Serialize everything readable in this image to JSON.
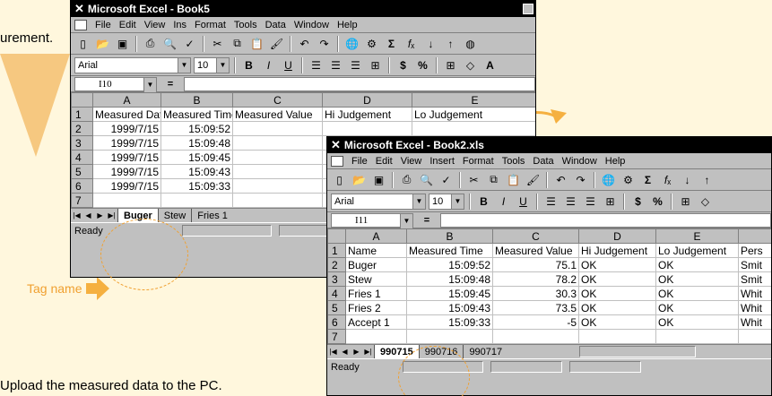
{
  "captions": {
    "top_fragment": "urement.",
    "bottom": "Upload the measured data to the PC.",
    "tag_name": "Tag name"
  },
  "colors": {
    "accent": "#f0a030",
    "background": "#fff7dd"
  },
  "window1": {
    "title": "Microsoft Excel - Book5",
    "menu": [
      "File",
      "Edit",
      "View",
      "Ins",
      "Format",
      "Tools",
      "Data",
      "Window",
      "Help"
    ],
    "font": "Arial",
    "size": "10",
    "cell_ref": "I10",
    "eq": "=",
    "columns": [
      "A",
      "B",
      "C",
      "D",
      "E"
    ],
    "rows": [
      {
        "n": "1",
        "cells": [
          "Measured Date",
          "Measured Time",
          "Measured Value",
          "Hi Judgement",
          "Lo Judgement"
        ]
      },
      {
        "n": "2",
        "cells": [
          "1999/7/15",
          "15:09:52",
          "",
          "",
          ""
        ]
      },
      {
        "n": "3",
        "cells": [
          "1999/7/15",
          "15:09:48",
          "",
          "",
          ""
        ]
      },
      {
        "n": "4",
        "cells": [
          "1999/7/15",
          "15:09:45",
          "",
          "",
          ""
        ]
      },
      {
        "n": "5",
        "cells": [
          "1999/7/15",
          "15:09:43",
          "",
          "",
          ""
        ]
      },
      {
        "n": "6",
        "cells": [
          "1999/7/15",
          "15:09:33",
          "",
          "",
          ""
        ]
      },
      {
        "n": "7",
        "cells": [
          "",
          "",
          "",
          "",
          ""
        ]
      }
    ],
    "tabs": [
      "Buger",
      "Stew",
      "Fries 1"
    ],
    "status": "Ready"
  },
  "window2": {
    "title": "Microsoft Excel - Book2.xls",
    "menu": [
      "File",
      "Edit",
      "View",
      "Insert",
      "Format",
      "Tools",
      "Data",
      "Window",
      "Help"
    ],
    "font": "Arial",
    "size": "10",
    "cell_ref": "I11",
    "eq": "=",
    "columns": [
      "A",
      "B",
      "C",
      "D",
      "E",
      ""
    ],
    "rows": [
      {
        "n": "1",
        "cells": [
          "Name",
          "Measured Time",
          "Measured Value",
          "Hi Judgement",
          "Lo Judgement",
          "Pers"
        ]
      },
      {
        "n": "2",
        "cells": [
          "Buger",
          "15:09:52",
          "75.1",
          "OK",
          "OK",
          "Smit"
        ]
      },
      {
        "n": "3",
        "cells": [
          "Stew",
          "15:09:48",
          "78.2",
          "OK",
          "OK",
          "Smit"
        ]
      },
      {
        "n": "4",
        "cells": [
          "Fries 1",
          "15:09:45",
          "30.3",
          "OK",
          "OK",
          "Whit"
        ]
      },
      {
        "n": "5",
        "cells": [
          "Fries 2",
          "15:09:43",
          "73.5",
          "OK",
          "OK",
          "Whit"
        ]
      },
      {
        "n": "6",
        "cells": [
          "Accept 1",
          "15:09:33",
          "-5",
          "OK",
          "OK",
          "Whit"
        ]
      },
      {
        "n": "7",
        "cells": [
          "",
          "",
          "",
          "",
          "",
          ""
        ]
      }
    ],
    "tabs": [
      "990715",
      "990716",
      "990717"
    ],
    "status": "Ready"
  }
}
